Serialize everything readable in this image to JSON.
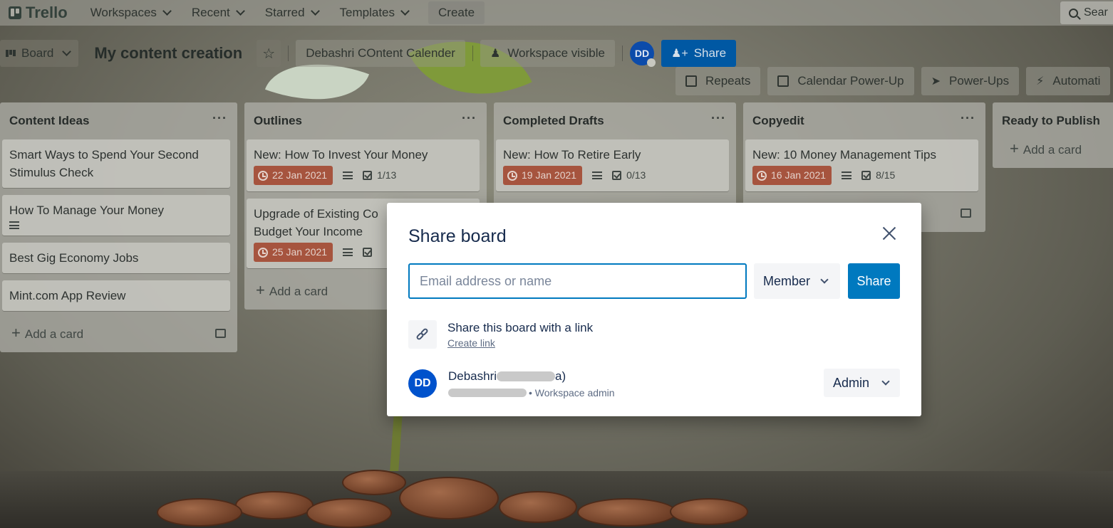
{
  "topbar": {
    "logo": "Trello",
    "nav": [
      "Workspaces",
      "Recent",
      "Starred",
      "Templates"
    ],
    "create": "Create",
    "search": "Sear"
  },
  "board": {
    "view": "Board",
    "title": "My content creation",
    "workspace": "Debashri COntent Calender",
    "visibility": "Workspace visible",
    "avatar": "DD",
    "share": "Share"
  },
  "powerups": [
    "Repeats",
    "Calendar Power-Up",
    "Power-Ups",
    "Automati"
  ],
  "lists": [
    {
      "title": "Content Ideas",
      "cards": [
        {
          "title": "Smart Ways to Spend Your Second Stimulus Check"
        },
        {
          "title": "How To Manage Your Money",
          "desc": true
        },
        {
          "title": "Best Gig Economy Jobs"
        },
        {
          "title": "Mint.com App Review"
        }
      ],
      "add": "Add a card"
    },
    {
      "title": "Outlines",
      "cards": [
        {
          "title": "New: How To Invest Your Money",
          "date": "22 Jan 2021",
          "checklist": "1/13"
        },
        {
          "title": "Upgrade of Existing Co… Budget Your Income",
          "title_line1": "Upgrade of Existing Co",
          "title_line2": "Budget Your Income",
          "date": "25 Jan 2021"
        }
      ],
      "add": "Add a card"
    },
    {
      "title": "Completed Drafts",
      "cards": [
        {
          "title": "New: How To Retire Early",
          "date": "19 Jan 2021",
          "checklist": "0/13"
        }
      ]
    },
    {
      "title": "Copyedit",
      "cards": [
        {
          "title": "New: 10 Money Management Tips",
          "date": "16 Jan 2021",
          "checklist": "8/15"
        }
      ]
    },
    {
      "title": "Ready to Publish",
      "add": "Add a card"
    }
  ],
  "modal": {
    "title": "Share board",
    "email_placeholder": "Email address or name",
    "role": "Member",
    "share": "Share",
    "link_title": "Share this board with a link",
    "link_action": "Create link",
    "member": {
      "initials": "DD",
      "name": "Debashri",
      "name_tail": "a)",
      "role_text": "• Workspace admin",
      "permission": "Admin"
    }
  },
  "colors": {
    "accent": "#0079bf",
    "due_overdue": "#a6543e",
    "avatar": "#0052cc"
  }
}
